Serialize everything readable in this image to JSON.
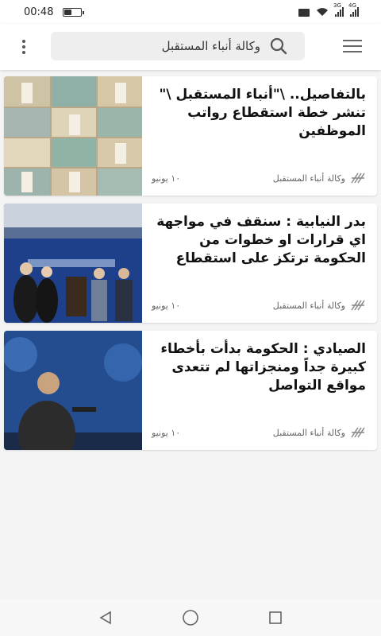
{
  "status_bar": {
    "time": "00:48",
    "battery_level": 0.45,
    "network_left": "3G",
    "network_right": "4G"
  },
  "header": {
    "search_text": "وكالة أنباء المستقبل"
  },
  "articles": [
    {
      "title": "بالتفاصيل.. \\\"أنباء المستقبل \\\" تنشر خطة استقطاع رواتب الموظفين",
      "source": "وكالة أنباء المستقبل",
      "date": "١٠ يونيو"
    },
    {
      "title": "بدر النيابية : سنقف في مواجهة اي قرارات او خطوات من الحكومة ترتكز على استقطاع",
      "source": "وكالة أنباء المستقبل",
      "date": "١٠ يونيو"
    },
    {
      "title": "الصيادي : الحكومة بدأت بأخطاء كبيرة جداً ومنجزاتها لم تتعدى مواقع التواصل",
      "source": "وكالة أنباء المستقبل",
      "date": "١٠ يونيو"
    }
  ],
  "colors": {
    "background": "#f4f4f4",
    "card": "#ffffff",
    "title_text": "#111111",
    "meta_text": "#666666"
  }
}
